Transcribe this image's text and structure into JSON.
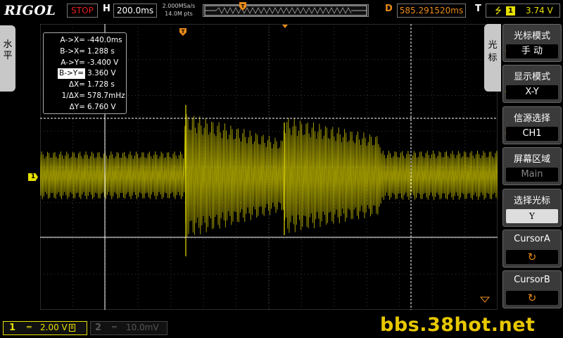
{
  "header": {
    "logo": "RIGOL",
    "run_state": "STOP",
    "h_label": "H",
    "timebase": "200.0ms",
    "sample_rate": "2.000MSa/s",
    "memory_depth": "14.0M pts",
    "d_label": "D",
    "trigger_delay": "585.291520ms",
    "t_label": "T",
    "trigger_source": "1",
    "trigger_level": "3.74 V",
    "trigger_edge_icon": "rising-edge-icon"
  },
  "left_tab": {
    "label": "水平"
  },
  "cursor_readout": {
    "rows": [
      {
        "key": "A->X=",
        "value": "-440.0ms"
      },
      {
        "key": "B->X=",
        "value": "1.288 s"
      },
      {
        "key": "A->Y=",
        "value": "-3.400 V"
      },
      {
        "key": "B->Y=",
        "value": "3.360 V",
        "selected": true
      },
      {
        "key": "ΔX=",
        "value": "1.728 s"
      },
      {
        "key": "1/ΔX=",
        "value": "578.7mHz"
      },
      {
        "key": "ΔY=",
        "value": "6.760 V"
      }
    ]
  },
  "channel_marker": "1",
  "menu": {
    "tab_label": "光标",
    "items": [
      {
        "title": "光标模式",
        "value": "手  动"
      },
      {
        "title": "显示模式",
        "value": "X-Y"
      },
      {
        "title": "信源选择",
        "value": "CH1"
      },
      {
        "title": "屏幕区域",
        "value": "Main"
      },
      {
        "title": "选择光标",
        "value": "Y"
      },
      {
        "title": "CursorA",
        "icon": "rotate-knob-icon"
      },
      {
        "title": "CursorB",
        "icon": "rotate-knob-icon"
      }
    ]
  },
  "bottom": {
    "ch1_num": "1",
    "ch1_coupling": "═",
    "ch1_scale": "2.00 V",
    "ch1_bw": "B",
    "ch2_num": "2",
    "ch2_coupling": "═",
    "ch2_scale": "10.0mV",
    "watermark": "bbs.38hot.net"
  },
  "colors": {
    "ch1": "#e8e000",
    "accent": "#e88a1a",
    "stop": "#e02020",
    "grid": "#4a4a4a"
  }
}
